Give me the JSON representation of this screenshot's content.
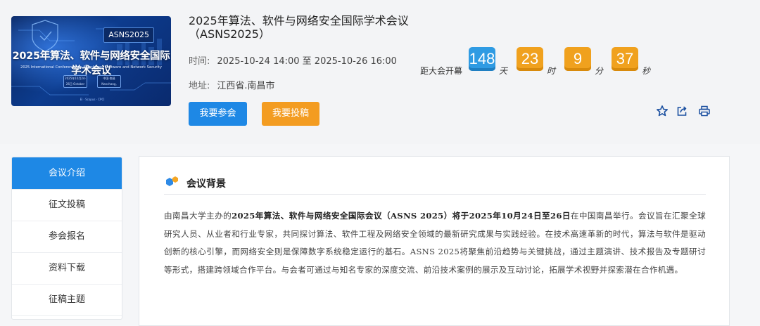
{
  "poster": {
    "badge": "ASNS2025",
    "title": "2025年算法、软件与网络安全国际学术会议",
    "subtitle": "2025 International Conference on Algorithms, Software and Network Security",
    "chip_left": "2025年10月24-26日 October 24-26",
    "chip_right": "中国·南昌 Nanchang, China",
    "strip": "EI · Scopus · CPCI"
  },
  "conference": {
    "title": "2025年算法、软件与网络安全国际学术会议（ASNS2025）",
    "time_label": "时间:",
    "time_value": "2025-10-24 14:00 至 2025-10-26 16:00",
    "address_label": "地址:",
    "address_value": "江西省.南昌市"
  },
  "buttons": {
    "register": "我要参会",
    "submit": "我要投稿"
  },
  "countdown": {
    "label": "距大会开幕",
    "days": "148",
    "days_unit": "天",
    "hours": "23",
    "hours_unit": "时",
    "minutes": "9",
    "minutes_unit": "分",
    "seconds": "37",
    "seconds_unit": "秒"
  },
  "toolbar_icons": [
    "star-icon",
    "share-icon",
    "print-icon"
  ],
  "sidebar": {
    "items": [
      {
        "label": "会议介绍"
      },
      {
        "label": "征文投稿"
      },
      {
        "label": "参会报名"
      },
      {
        "label": "资料下载"
      },
      {
        "label": "征稿主题"
      }
    ]
  },
  "section": {
    "title": "会议背景",
    "intro_prefix": "由南昌大学主办的",
    "intro_bold_1": "2025年算法、软件与网络安全国际会议（ASNS 2025）将于2025年10月24日至26日",
    "intro_rest": "在中国南昌举行。会议旨在汇聚全球研究人员、从业者和行业专家，共同探讨算法、软件工程及网络安全领域的最新研究成果与实践经验。在技术高速革新的时代，算法与软件是驱动创新的核心引擎，而网络安全则是保障数字系统稳定运行的基石。ASNS 2025将聚焦前沿趋势与关键挑战，通过主题演讲、技术报告及专题研讨等形式，搭建跨领域合作平台。与会者可通过与知名专家的深度交流、前沿技术案例的展示及互动讨论，拓展学术视野并探索潜在合作机遇。"
  },
  "colors": {
    "primary": "#1e88e5",
    "accent": "#f39c21",
    "countdown_days": "#2f9be3",
    "countdown_other": "#f0a11e"
  }
}
